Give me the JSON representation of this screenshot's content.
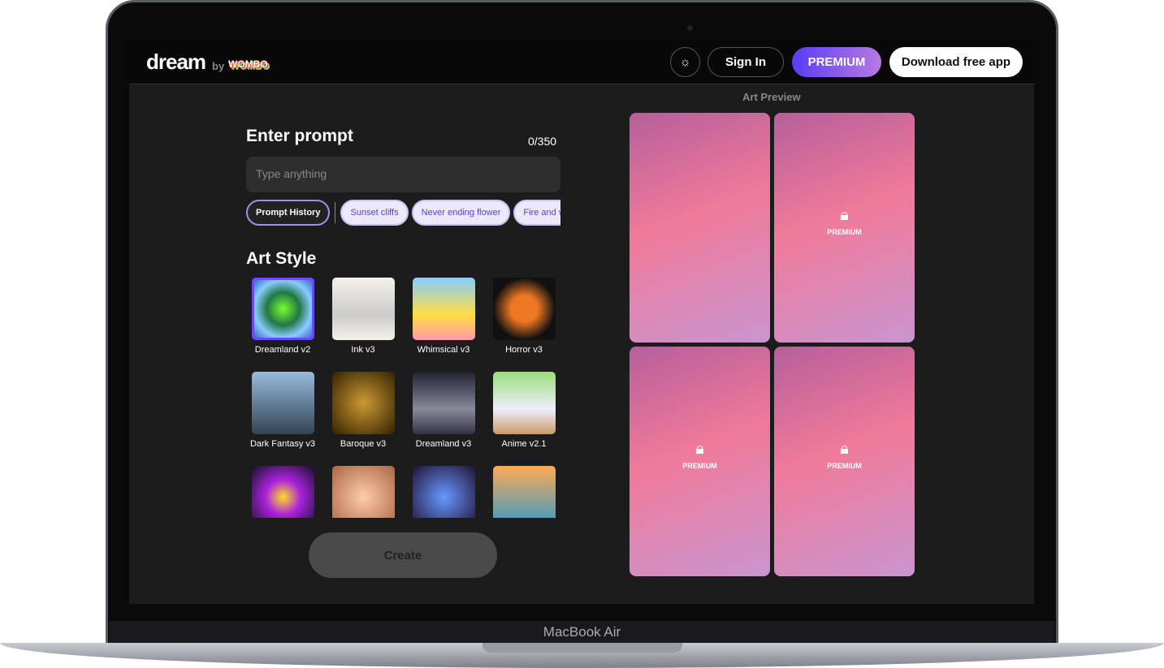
{
  "device": {
    "label": "MacBook Air"
  },
  "header": {
    "logo": "dream",
    "by": "by",
    "brand": "WOMBO",
    "theme_icon": "sun-icon",
    "sign_in": "Sign In",
    "premium": "PREMIUM",
    "download": "Download free app"
  },
  "prompt": {
    "title": "Enter prompt",
    "count": "0/350",
    "placeholder": "Type anything",
    "history": "Prompt History",
    "suggestions": [
      "Sunset cliffs",
      "Never ending flower",
      "Fire and w"
    ]
  },
  "art_style": {
    "title": "Art Style",
    "styles": [
      {
        "label": "Dreamland v2",
        "selected": true
      },
      {
        "label": "Ink v3"
      },
      {
        "label": "Whimsical v3"
      },
      {
        "label": "Horror v3"
      },
      {
        "label": "Dark Fantasy v3"
      },
      {
        "label": "Baroque v3"
      },
      {
        "label": "Dreamland v3"
      },
      {
        "label": "Anime v2.1"
      },
      {
        "label": ""
      },
      {
        "label": ""
      },
      {
        "label": ""
      },
      {
        "label": ""
      }
    ]
  },
  "create": "Create",
  "preview": {
    "title": "Art Preview",
    "lock_icon": "lock-icon",
    "premium_label": "PREMIUM"
  }
}
